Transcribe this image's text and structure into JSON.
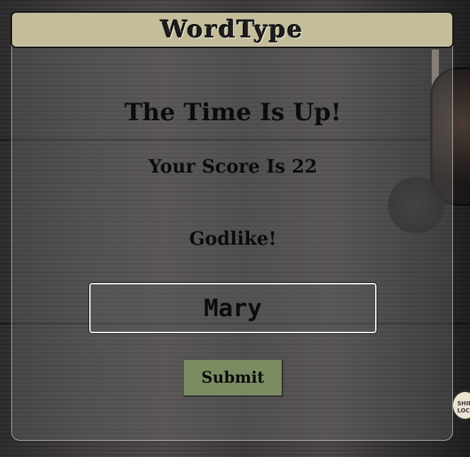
{
  "header": {
    "title": "WordType"
  },
  "result": {
    "headline": "The Time Is Up!",
    "score_text": "Your Score Is 22",
    "rank_text": "Godlike!"
  },
  "name_input": {
    "value": "Mary"
  },
  "submit": {
    "label": "Submit"
  },
  "background": {
    "shift_key_label": "SHIFT LOCK"
  },
  "colors": {
    "header_bg": "#c4bd9c",
    "button_bg": "#7c8c62"
  }
}
